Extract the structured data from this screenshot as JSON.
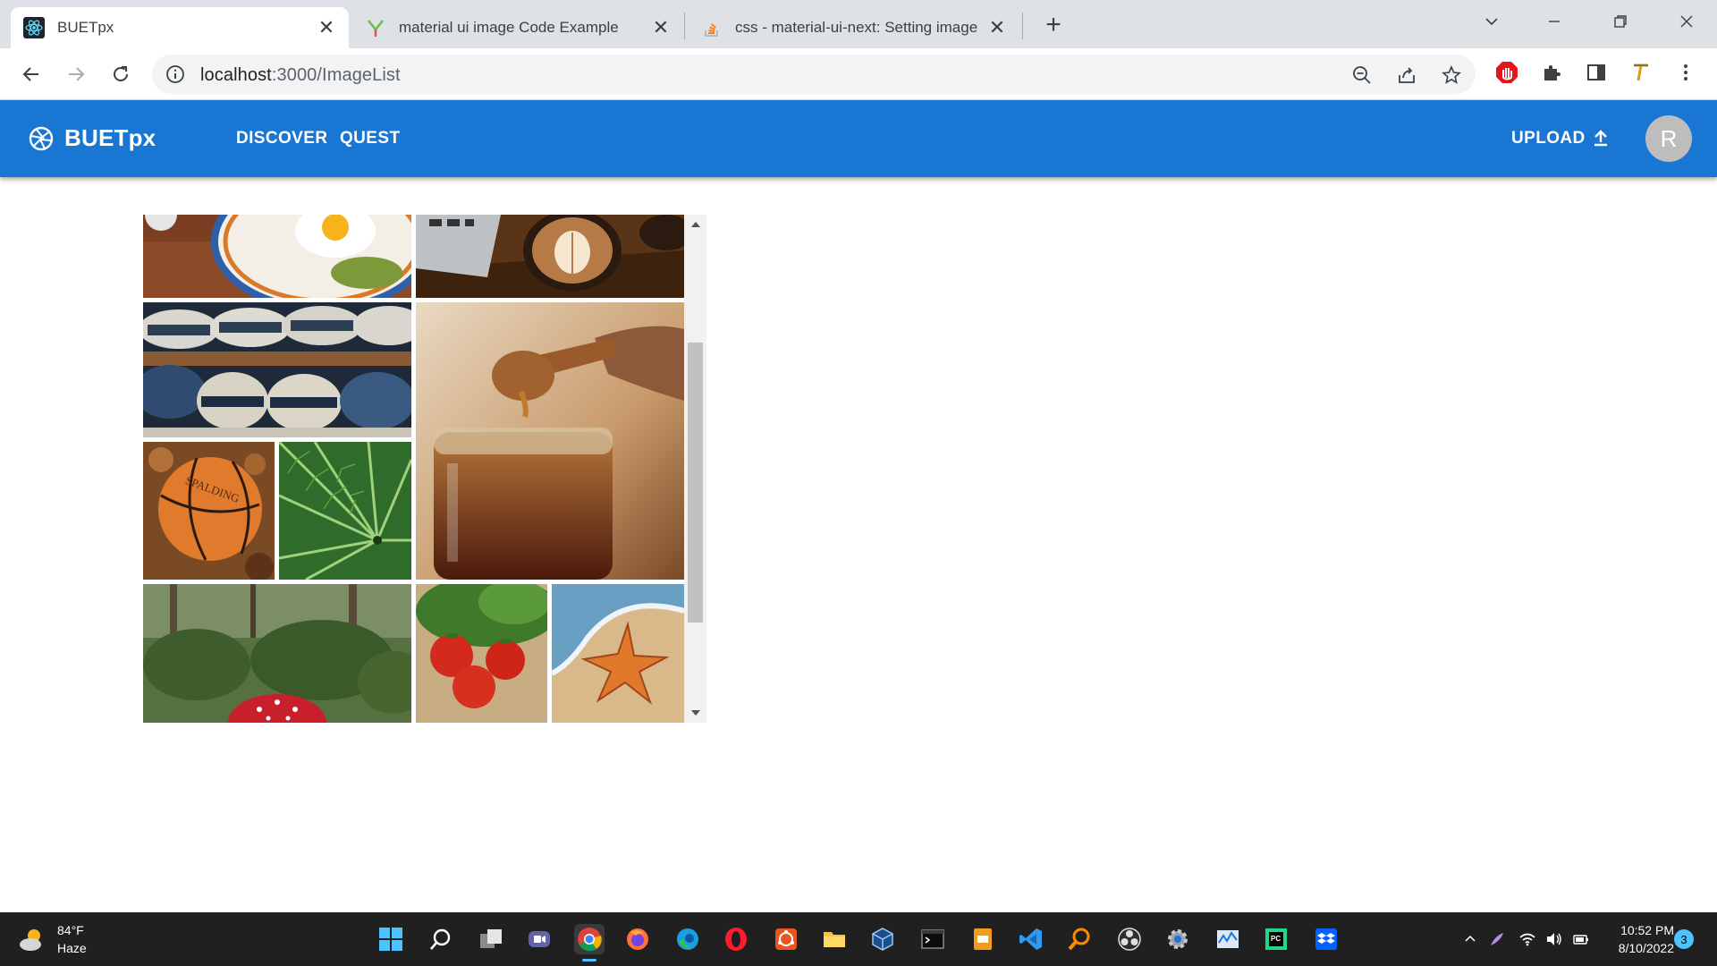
{
  "browser": {
    "tabs": [
      {
        "title": "BUETpx",
        "active": true,
        "favicon": "react-icon"
      },
      {
        "title": "material ui image Code Example",
        "active": false,
        "favicon": "grepper-icon"
      },
      {
        "title": "css - material-ui-next: Setting image",
        "active": false,
        "favicon": "stackoverflow-icon"
      }
    ],
    "url_host": "localhost",
    "url_path": ":3000/ImageList"
  },
  "app": {
    "brand": "BUETpx",
    "nav": [
      {
        "label": "DISCOVER"
      },
      {
        "label": "QUEST"
      }
    ],
    "upload_label": "UPLOAD",
    "avatar_initial": "R"
  },
  "image_list": {
    "images": [
      {
        "title": "Breakfast",
        "icon": "breakfast-plate-image"
      },
      {
        "title": "Coffee",
        "icon": "latte-coffee-image"
      },
      {
        "title": "Hats",
        "icon": "hats-image"
      },
      {
        "title": "Honey",
        "icon": "honey-jar-image"
      },
      {
        "title": "Basketball",
        "icon": "basketball-image"
      },
      {
        "title": "Fern",
        "icon": "fern-image"
      },
      {
        "title": "Mushrooms",
        "icon": "mushroom-image"
      },
      {
        "title": "Tomato basil",
        "icon": "tomato-basil-image"
      },
      {
        "title": "Sea star",
        "icon": "sea-star-image"
      }
    ]
  },
  "taskbar": {
    "weather_temp": "84°F",
    "weather_desc": "Haze",
    "time": "10:52 PM",
    "date": "8/10/2022",
    "notifications": "3"
  },
  "colors": {
    "appbar": "#1976d2",
    "avatar": "#bdbdbd",
    "taskbar": "#202020"
  }
}
